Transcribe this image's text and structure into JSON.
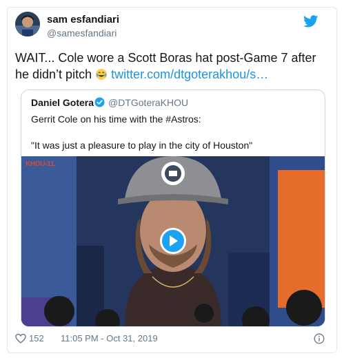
{
  "tweet": {
    "author_name": "sam esfandiari",
    "author_handle": "@samesfandiari",
    "text_before_emoji": "WAIT... Cole wore a Scott Boras hat post-Game 7 after he didn’t pitch",
    "link_text": "twitter.com/dtgoterakhou/s…",
    "emoji_icon": "face-with-tears-of-joy-icon",
    "likes": "152",
    "timestamp": "11:05 PM - Oct 31, 2019"
  },
  "quoted": {
    "author_name": "Daniel Gotera",
    "author_handle": "@DTGoteraKHOU",
    "line1": "Gerrit Cole on his time with the #Astros:",
    "line2": "\"It was just a pleasure to play in the city of Houston\"",
    "station_logo": "KHOU-11."
  },
  "icons": {
    "brand": "twitter-bird-icon",
    "verified": "verified-badge-icon",
    "like": "heart-icon",
    "info": "info-icon",
    "play": "play-icon"
  },
  "colors": {
    "link": "#1b95e0",
    "twitter_blue": "#1da1f2",
    "muted": "#657786",
    "border": "#e1e8ed"
  }
}
